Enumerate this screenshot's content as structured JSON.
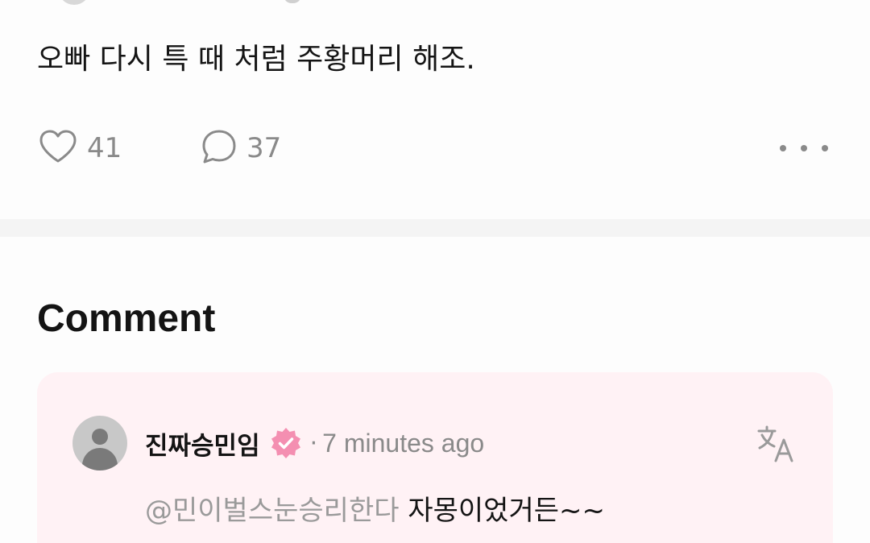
{
  "post": {
    "body": "오빠 다시 특 때 처럼 주황머리 해조.",
    "likes": "41",
    "comments": "37"
  },
  "icons": {
    "like": "heart-outline-icon",
    "comment": "speech-bubble-icon",
    "more": "more-horizontal-icon",
    "translate": "translate-icon",
    "verified": "verified-badge-icon",
    "avatar": "default-avatar-icon"
  },
  "comment_section": {
    "heading": "Comment",
    "items": [
      {
        "author": "진짜승민임",
        "separator": "·",
        "timestamp": "7 minutes ago",
        "mention": "@민이벌스눈승리한다",
        "text": " 자몽이었거든~~"
      }
    ]
  },
  "colors": {
    "accent_pink": "#f48fb1",
    "card_background": "#fff2f5",
    "muted_text": "#8a8a8a"
  }
}
